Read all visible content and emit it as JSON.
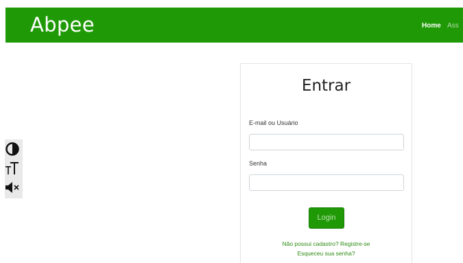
{
  "navbar": {
    "brand": "Abpee",
    "links": [
      {
        "label": "Home"
      },
      {
        "label": "Ass"
      }
    ]
  },
  "accessibility": {
    "icons": [
      "contrast-icon",
      "font-size-icon",
      "mute-icon"
    ]
  },
  "login": {
    "title": "Entrar",
    "email_label": "E-mail ou Usuário",
    "email_value": "",
    "password_label": "Senha",
    "password_value": "",
    "submit_label": "Login",
    "register_link": "Não possui cadastro? Registre-se",
    "forgot_link": "Esqueceu sua senha?"
  },
  "colors": {
    "brand_green": "#1f9a06",
    "link_green": "#2b8a12"
  }
}
